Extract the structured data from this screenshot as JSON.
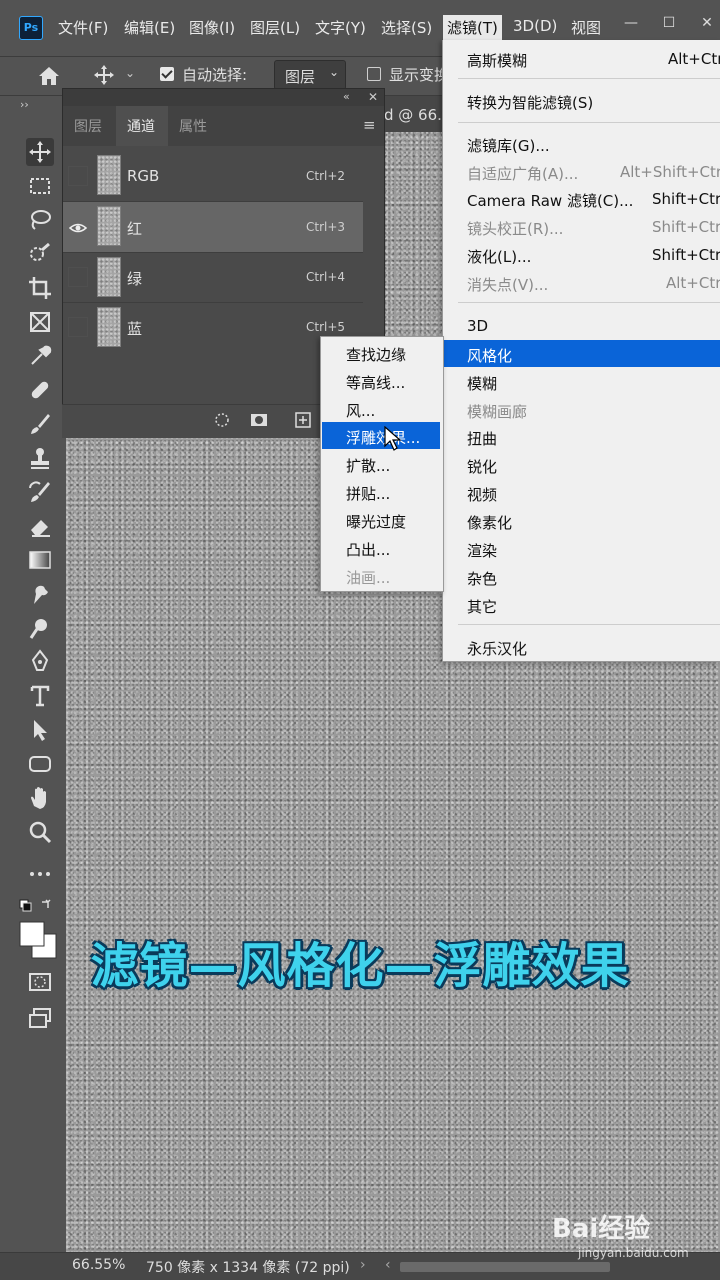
{
  "app": {
    "logo": "Ps"
  },
  "menubar": {
    "items": [
      "文件(F)",
      "编辑(E)",
      "图像(I)",
      "图层(L)",
      "文字(Y)",
      "选择(S)",
      "滤镜(T)",
      "3D(D)",
      "视图"
    ],
    "active": "滤镜(T)"
  },
  "options_bar": {
    "auto_select_label": "自动选择:",
    "auto_select_checked": true,
    "layer_select_value": "图层",
    "show_transform_label": "显示变换"
  },
  "document": {
    "tab_text": "d @ 66."
  },
  "channels_panel": {
    "tabs": [
      "图层",
      "通道",
      "属性"
    ],
    "active_tab": "通道",
    "channels": [
      {
        "name": "RGB",
        "shortcut": "Ctrl+2",
        "visible": false
      },
      {
        "name": "红",
        "shortcut": "Ctrl+3",
        "visible": true
      },
      {
        "name": "绿",
        "shortcut": "Ctrl+4",
        "visible": false
      },
      {
        "name": "蓝",
        "shortcut": "Ctrl+5",
        "visible": false
      }
    ]
  },
  "filter_menu": {
    "items": [
      {
        "label": "高斯模糊",
        "shortcut": "Alt+Ctrl",
        "disabled": false
      },
      {
        "label": "转换为智能滤镜(S)",
        "shortcut": "",
        "disabled": false
      },
      {
        "label": "滤镜库(G)...",
        "shortcut": "",
        "disabled": false
      },
      {
        "label": "自适应广角(A)...",
        "shortcut": "Alt+Shift+Ctr",
        "disabled": true
      },
      {
        "label": "Camera Raw 滤镜(C)...",
        "shortcut": "Shift+Ctr",
        "disabled": false
      },
      {
        "label": "镜头校正(R)...",
        "shortcut": "Shift+Ctr",
        "disabled": true
      },
      {
        "label": "液化(L)...",
        "shortcut": "Shift+Ctr",
        "disabled": false
      },
      {
        "label": "消失点(V)...",
        "shortcut": "Alt+Ctr",
        "disabled": true
      },
      {
        "label": "3D",
        "shortcut": "",
        "disabled": false
      },
      {
        "label": "风格化",
        "shortcut": "",
        "disabled": false,
        "highlighted": true
      },
      {
        "label": "模糊",
        "shortcut": "",
        "disabled": false
      },
      {
        "label": "模糊画廊",
        "shortcut": "",
        "disabled": true
      },
      {
        "label": "扭曲",
        "shortcut": "",
        "disabled": false
      },
      {
        "label": "锐化",
        "shortcut": "",
        "disabled": false
      },
      {
        "label": "视频",
        "shortcut": "",
        "disabled": false
      },
      {
        "label": "像素化",
        "shortcut": "",
        "disabled": false
      },
      {
        "label": "渲染",
        "shortcut": "",
        "disabled": false
      },
      {
        "label": "杂色",
        "shortcut": "",
        "disabled": false
      },
      {
        "label": "其它",
        "shortcut": "",
        "disabled": false
      },
      {
        "label": "永乐汉化",
        "shortcut": "",
        "disabled": false
      }
    ]
  },
  "stylize_submenu": {
    "items": [
      {
        "label": "查找边缘",
        "disabled": false
      },
      {
        "label": "等高线...",
        "disabled": false
      },
      {
        "label": "风...",
        "disabled": false
      },
      {
        "label": "浮雕效果...",
        "disabled": false,
        "highlighted": true
      },
      {
        "label": "扩散...",
        "disabled": false
      },
      {
        "label": "拼贴...",
        "disabled": false
      },
      {
        "label": "曝光过度",
        "disabled": false
      },
      {
        "label": "凸出...",
        "disabled": false
      },
      {
        "label": "油画...",
        "disabled": true
      }
    ]
  },
  "caption": "滤镜—风格化—浮雕效果",
  "status_bar": {
    "zoom": "66.55%",
    "doc_info": "750 像素 x 1334 像素 (72 ppi)"
  },
  "watermark": {
    "brand": "Bai经验",
    "url": "jingyan.baidu.com"
  },
  "colors": {
    "accent": "#0a64d8",
    "caption": "#3fd2ec",
    "ui_bg": "#535353",
    "ps_blue": "#31a8ff"
  }
}
